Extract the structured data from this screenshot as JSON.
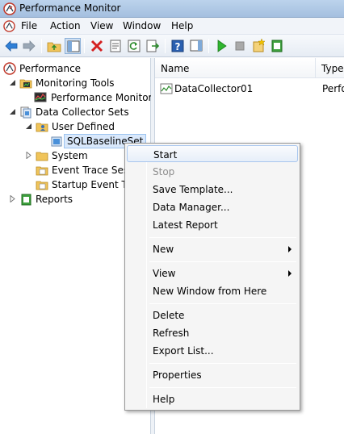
{
  "window": {
    "title": "Performance Monitor"
  },
  "menubar": {
    "items": [
      "File",
      "Action",
      "View",
      "Window",
      "Help"
    ]
  },
  "toolbar": {
    "buttons": [
      "back-icon",
      "forward-icon",
      "up-folder-icon",
      "show-hide-tree-icon",
      "delete-icon",
      "properties-icon",
      "refresh-icon",
      "export-icon",
      "help-icon",
      "show-hide-action-pane-icon",
      "start-icon",
      "stop-icon",
      "new-icon",
      "report-icon"
    ]
  },
  "tree": {
    "root": "Performance",
    "monitoring_tools": "Monitoring Tools",
    "performance_monitor": "Performance Monitor",
    "data_collector_sets": "Data Collector Sets",
    "user_defined": "User Defined",
    "sql_baseline_set": "SQLBaselineSet",
    "system": "System",
    "event_trace_sessions": "Event Trace Sessi",
    "startup_event_trace": "Startup Event Tra",
    "reports": "Reports"
  },
  "list": {
    "columns": [
      "Name",
      "Type"
    ],
    "rows": [
      {
        "name": "DataCollector01",
        "type": "Perfo"
      }
    ]
  },
  "context_menu": {
    "start": "Start",
    "stop": "Stop",
    "save_template": "Save Template...",
    "data_manager": "Data Manager...",
    "latest_report": "Latest Report",
    "new": "New",
    "view": "View",
    "new_window": "New Window from Here",
    "delete": "Delete",
    "refresh": "Refresh",
    "export_list": "Export List...",
    "properties": "Properties",
    "help": "Help"
  },
  "colors": {
    "accent": "#3399ff",
    "menu_hover_border": "#a8c6ee",
    "title_bar": "#b4cde9"
  }
}
